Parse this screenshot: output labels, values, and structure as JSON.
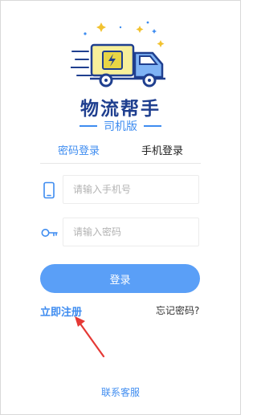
{
  "app": {
    "title": "物流帮手",
    "subtitle": "司机版"
  },
  "tabs": [
    {
      "label": "密码登录",
      "active": true
    },
    {
      "label": "手机登录",
      "active": false
    }
  ],
  "form": {
    "phone_placeholder": "请输入手机号",
    "password_placeholder": "请输入密码",
    "login_label": "登录"
  },
  "links": {
    "register": "立即注册",
    "forgot": "忘记密码?",
    "support": "联系客服"
  },
  "colors": {
    "accent": "#3e8cf0",
    "button": "#5a9ff7",
    "title": "#1f3f8f",
    "arrow": "#e53935"
  }
}
